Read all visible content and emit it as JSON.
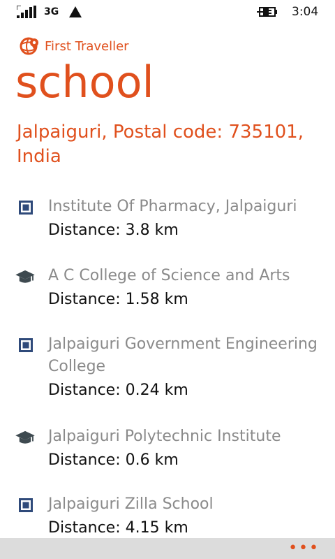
{
  "status": {
    "network": "3G",
    "time": "3:04"
  },
  "app": {
    "name": "First Traveller"
  },
  "page": {
    "title": "school",
    "location": "Jalpaiguri, Postal code: 735101, India"
  },
  "places": [
    {
      "name": "Institute Of Pharmacy, Jalpaiguri",
      "distance": "Distance: 3.8 km",
      "icon": "square-place-icon"
    },
    {
      "name": "A C College of Science and Arts",
      "distance": "Distance: 1.58 km",
      "icon": "graduation-cap-icon"
    },
    {
      "name": "Jalpaiguri Government Engineering College",
      "distance": "Distance: 0.24 km",
      "icon": "square-place-icon"
    },
    {
      "name": "Jalpaiguri Polytechnic Institute",
      "distance": "Distance: 0.6 km",
      "icon": "graduation-cap-icon"
    },
    {
      "name": "Jalpaiguri Zilla School",
      "distance": "Distance: 4.15 km",
      "icon": "square-place-icon"
    }
  ],
  "appbar": {
    "more": "•••"
  },
  "colors": {
    "accent": "#e0501d",
    "muted_text": "#8a8a8a",
    "appbar": "#dcdcdc",
    "icon_blue": "#2f4a7a",
    "icon_dark": "#3e4a50"
  }
}
